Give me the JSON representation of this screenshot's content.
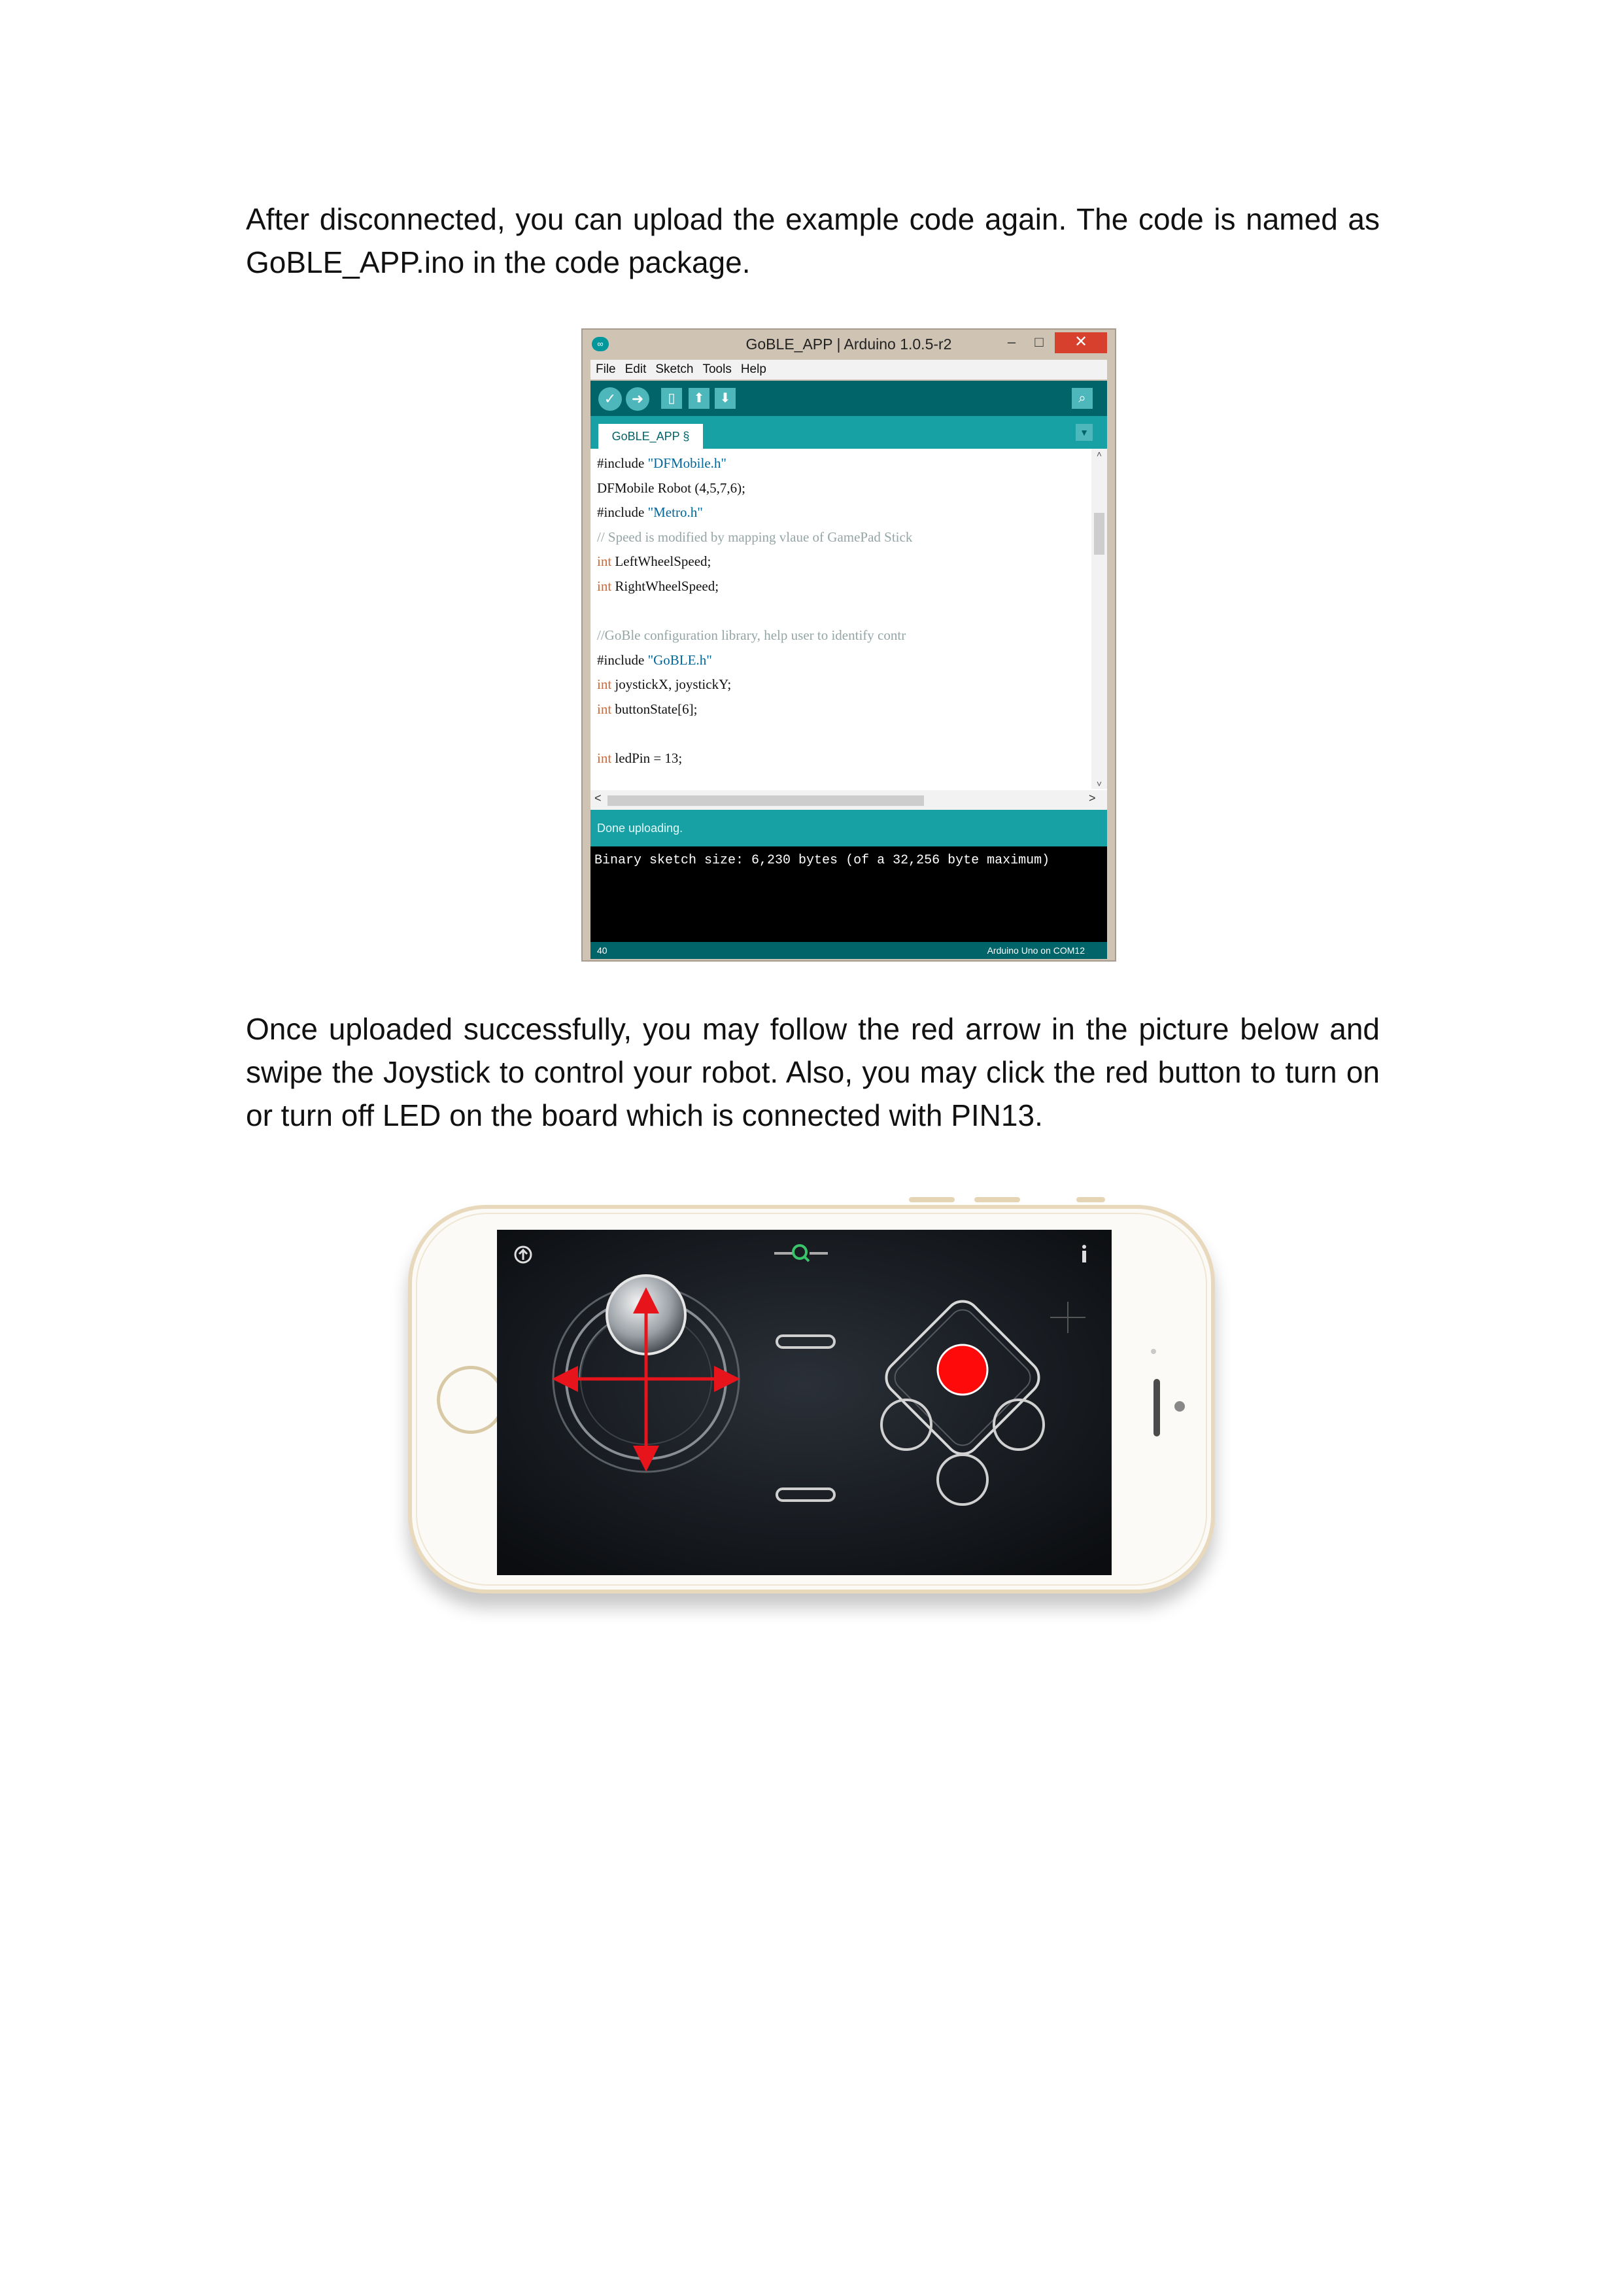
{
  "paragraphs": {
    "p1": "After disconnected, you can upload the example code again. The code is named as GoBLE_APP.ino in the code package.",
    "p2": "Once uploaded successfully, you may follow the red arrow in the picture below and swipe the Joystick to control your robot. Also, you may click the red button to turn on or turn off LED on the board which is connected with PIN13."
  },
  "ide": {
    "title": "GoBLE_APP | Arduino 1.0.5-r2",
    "logo": "∞",
    "window_controls": {
      "minimize": "‒",
      "maximize": "□",
      "close": "✕"
    },
    "menu": [
      "File",
      "Edit",
      "Sketch",
      "Tools",
      "Help"
    ],
    "toolbar": {
      "verify_icon": "✓",
      "upload_icon": "➜",
      "new_icon": "▯",
      "open_icon": "⬆",
      "save_icon": "⬇",
      "serial_monitor_icon": "⌕"
    },
    "tab_label": "GoBLE_APP §",
    "tab_menu_icon": "▼",
    "code": [
      {
        "a": "#include ",
        "s": "\"DFMobile.h\"",
        "k": "",
        "r": "",
        "c": ""
      },
      {
        "a": "DFMobile Robot (4,5,7,6);",
        "s": "",
        "k": "",
        "r": "",
        "c": ""
      },
      {
        "a": "#include ",
        "s": "\"Metro.h\"",
        "k": "",
        "r": "",
        "c": ""
      },
      {
        "a": "",
        "s": "",
        "k": "",
        "r": "",
        "c": "// Speed is modified by mapping vlaue of GamePad Stick"
      },
      {
        "a": "",
        "s": "",
        "k": "int",
        "r": " LeftWheelSpeed;",
        "c": ""
      },
      {
        "a": "",
        "s": "",
        "k": "int",
        "r": " RightWheelSpeed;",
        "c": ""
      },
      {
        "a": "",
        "s": "",
        "k": "",
        "r": "",
        "c": ""
      },
      {
        "a": "",
        "s": "",
        "k": "",
        "r": "",
        "c": "//GoBle configuration library, help user to identify contr"
      },
      {
        "a": "#include ",
        "s": "\"GoBLE.h\"",
        "k": "",
        "r": "",
        "c": ""
      },
      {
        "a": "",
        "s": "",
        "k": "int",
        "r": " joystickX, joystickY;",
        "c": ""
      },
      {
        "a": "",
        "s": "",
        "k": "int",
        "r": " buttonState[6];",
        "c": ""
      },
      {
        "a": "",
        "s": "",
        "k": "",
        "r": "",
        "c": ""
      },
      {
        "a": "",
        "s": "",
        "k": "int",
        "r": " ledPin = 13;",
        "c": ""
      }
    ],
    "scroll": {
      "up": "˄",
      "down": "˅",
      "left": "<",
      "right": ">"
    },
    "status": "Done uploading.",
    "console": "Binary sketch size: 6,230 bytes (of a 32,256 byte maximum)",
    "footer_line": "40",
    "footer_board": "Arduino Uno on COM12"
  },
  "phone_app": {
    "joystick_arrow_color": "#e8141b",
    "led_button_color": "#ff0a0a",
    "icons": {
      "top_left": "upload-circle-icon",
      "top_center": "search-icon",
      "top_right": "info-icon"
    }
  },
  "colors": {
    "arduino_dark": "#006468",
    "arduino_teal": "#17a1a5",
    "red": "#e8141b"
  }
}
